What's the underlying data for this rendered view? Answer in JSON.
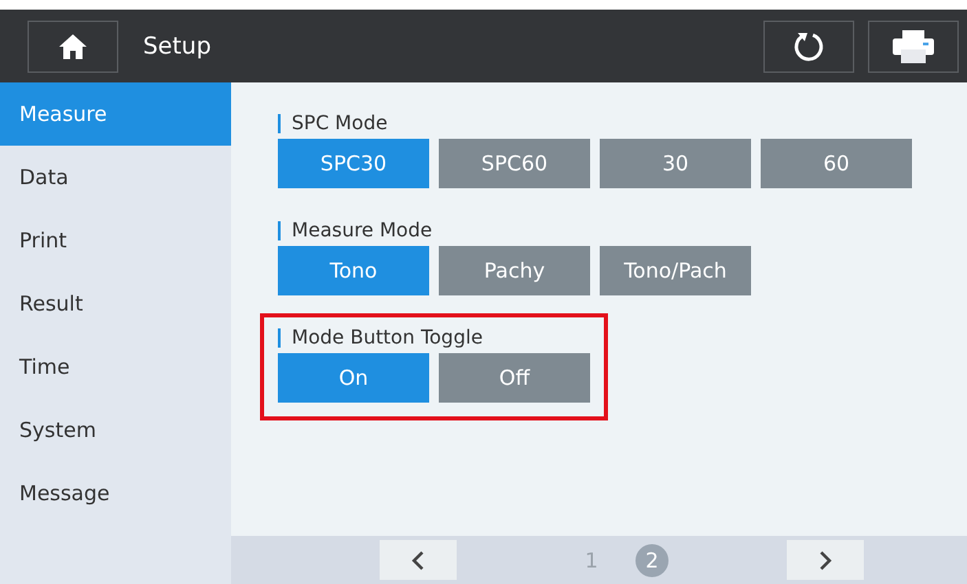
{
  "header": {
    "title": "Setup"
  },
  "sidebar": {
    "items": [
      {
        "label": "Measure",
        "selected": true
      },
      {
        "label": "Data",
        "selected": false
      },
      {
        "label": "Print",
        "selected": false
      },
      {
        "label": "Result",
        "selected": false
      },
      {
        "label": "Time",
        "selected": false
      },
      {
        "label": "System",
        "selected": false
      },
      {
        "label": "Message",
        "selected": false
      }
    ]
  },
  "sections": [
    {
      "title": "SPC Mode",
      "highlighted": false,
      "options": [
        {
          "label": "SPC30",
          "selected": true
        },
        {
          "label": "SPC60",
          "selected": false
        },
        {
          "label": "30",
          "selected": false
        },
        {
          "label": "60",
          "selected": false
        }
      ]
    },
    {
      "title": "Measure Mode",
      "highlighted": false,
      "options": [
        {
          "label": "Tono",
          "selected": true
        },
        {
          "label": "Pachy",
          "selected": false
        },
        {
          "label": "Tono/Pach",
          "selected": false
        }
      ]
    },
    {
      "title": "Mode Button Toggle",
      "highlighted": true,
      "options": [
        {
          "label": "On",
          "selected": true
        },
        {
          "label": "Off",
          "selected": false
        }
      ]
    }
  ],
  "pager": {
    "pages": [
      {
        "label": "1",
        "selected": false
      },
      {
        "label": "2",
        "selected": true
      }
    ]
  }
}
